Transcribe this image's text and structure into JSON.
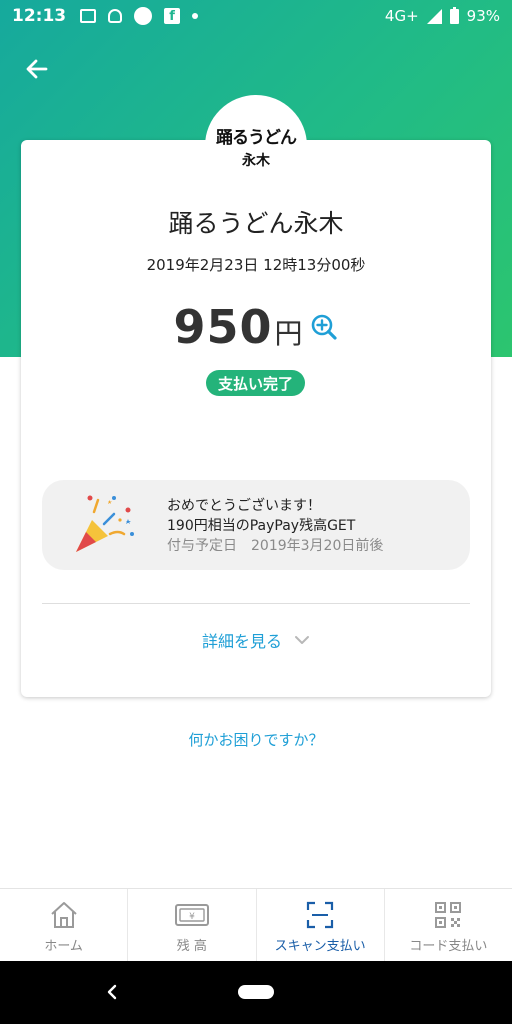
{
  "status_bar": {
    "time": "12:13",
    "network": "4G+",
    "battery": "93%"
  },
  "header": {
    "back_icon": "arrow-left-icon"
  },
  "store": {
    "logo_text_main": "踊るうどん",
    "logo_text_sub": "永木",
    "name": "踊るうどん永木",
    "datetime": "2019年2月23日 12時13分00秒"
  },
  "payment": {
    "amount": "950",
    "currency": "円",
    "status": "支払い完了"
  },
  "reward": {
    "line1": "おめでとうございます！",
    "line2": "190円相当のPayPay残高GET",
    "scheduled_label": "付与予定日",
    "scheduled_date": "2019年3月20日前後"
  },
  "details_label": "詳細を見る",
  "help_label": "何かお困りですか？",
  "tabs": [
    {
      "label": "ホーム",
      "icon": "home-icon"
    },
    {
      "label": "残 高",
      "icon": "wallet-icon"
    },
    {
      "label": "スキャン支払い",
      "icon": "scan-icon"
    },
    {
      "label": "コード支払い",
      "icon": "qr-code-icon"
    }
  ],
  "colors": {
    "accent": "#1f9fd6",
    "status_green": "#24b37a",
    "active_tab": "#1a5ea8"
  }
}
